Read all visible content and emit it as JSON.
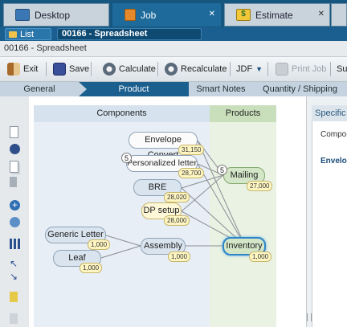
{
  "tabs": [
    {
      "label": "Desktop",
      "icon": "desktop-icon",
      "active": false
    },
    {
      "label": "Job",
      "icon": "job-icon",
      "active": true
    },
    {
      "label": "Estimate",
      "icon": "estimate-icon",
      "active": false
    }
  ],
  "header": {
    "list_label": "List",
    "job_title": "00166 - Spreadsheet"
  },
  "breadcrumb": "00166 - Spreadsheet",
  "toolbar": {
    "exit": "Exit",
    "save": "Save",
    "calculate": "Calculate",
    "recalculate": "Recalculate",
    "jdf": "JDF",
    "print_job": "Print Job",
    "more": "Su"
  },
  "steps": [
    "General",
    "Product",
    "Smart Notes",
    "Quantity / Shipping"
  ],
  "active_step": "Product",
  "canvas": {
    "components_header": "Components",
    "products_header": "Products",
    "nodes": [
      {
        "label": "Envelope Convert",
        "qty": "31,150"
      },
      {
        "label": "Personalized letter",
        "qty": "28,700",
        "badge": "5"
      },
      {
        "label": "BRE",
        "qty": "28,020"
      },
      {
        "label": "DP setup",
        "qty": "28,000"
      },
      {
        "label": "Generic Letter",
        "qty": "1,000"
      },
      {
        "label": "Leaf",
        "qty": "1,000"
      },
      {
        "label": "Assembly",
        "qty": "1,000"
      },
      {
        "label": "Mailing",
        "qty": "27,000",
        "badge": "5"
      },
      {
        "label": "Inventory",
        "qty": "1,000"
      }
    ]
  },
  "right_panel": {
    "header": "Specific",
    "row1": "Compor",
    "row2": "Envelo"
  },
  "colors": {
    "tabbar": "#16567f",
    "active_step": "#1b5f8f",
    "selection": "#2e86c8"
  }
}
